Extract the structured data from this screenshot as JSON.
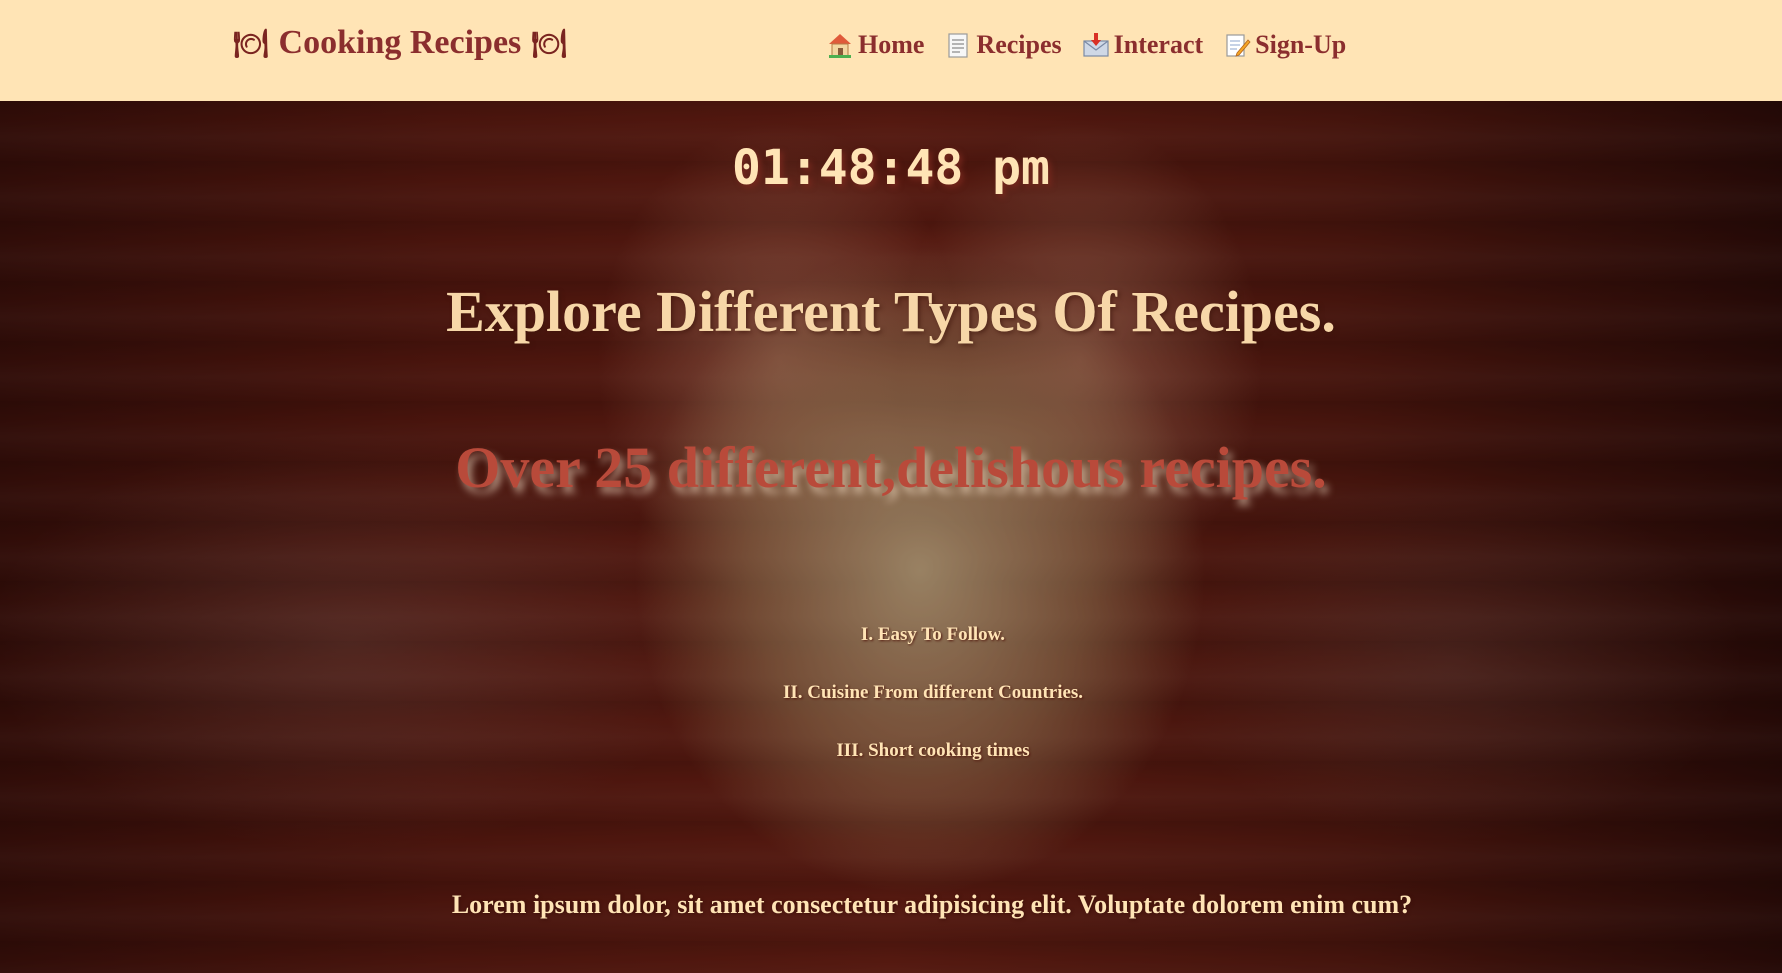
{
  "navbar": {
    "brand": "Cooking Recipes",
    "brand_icon": "plate-icon",
    "links": [
      {
        "label": "Home",
        "icon": "house-icon"
      },
      {
        "label": "Recipes",
        "icon": "page-icon"
      },
      {
        "label": "Interact",
        "icon": "inbox-tray-icon"
      },
      {
        "label": "Sign-Up",
        "icon": "memo-icon"
      }
    ]
  },
  "hero": {
    "clock": "01:48:48 pm",
    "headline": "Explore Different Types Of Recipes.",
    "subline": "Over 25 different,delishous recipes.",
    "features": [
      "I. Easy To Follow.",
      "II. Cuisine From different Countries.",
      "III. Short cooking times"
    ],
    "footer_text": "Lorem ipsum dolor, sit amet consectetur adipisicing elit. Voluptate dolorem enim cum?"
  },
  "colors": {
    "navbar_bg": "#ffe4b5",
    "brand_text": "#8b2e2e",
    "headline": "#f7d7a8",
    "subline": "#b94a3a"
  }
}
